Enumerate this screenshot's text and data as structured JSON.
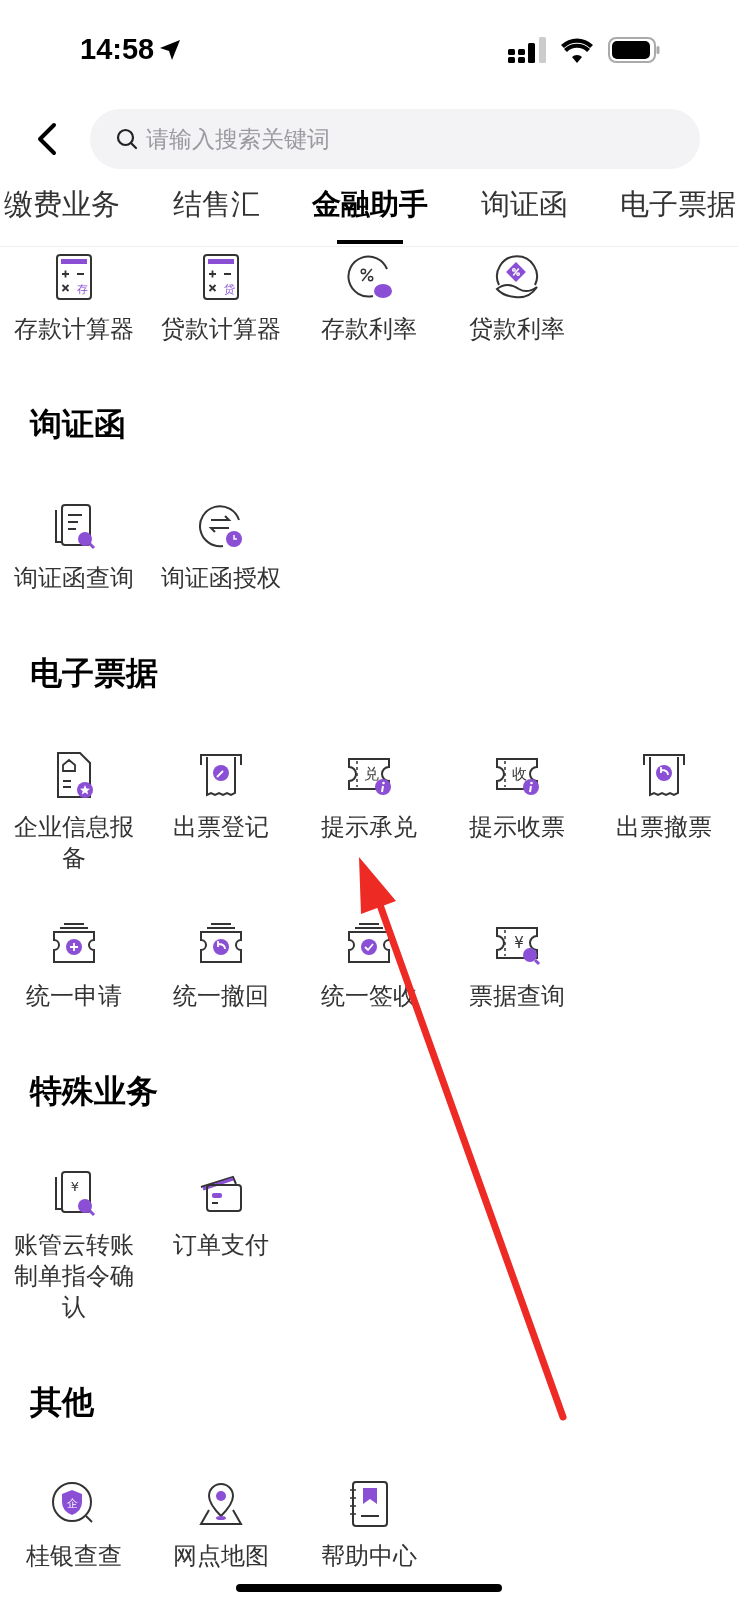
{
  "status_bar": {
    "time": "14:58"
  },
  "search": {
    "placeholder": "请输入搜索关键词"
  },
  "tabs": [
    {
      "label": "缴费业务",
      "selected": false
    },
    {
      "label": "结售汇",
      "selected": false
    },
    {
      "label": "金融助手",
      "selected": true
    },
    {
      "label": "询证函",
      "selected": false
    },
    {
      "label": "电子票据",
      "selected": false
    }
  ],
  "top_items": [
    {
      "label": "存款计算器",
      "kind": "calculator",
      "glyph": "存"
    },
    {
      "label": "贷款计算器",
      "kind": "calculator",
      "glyph": "贷"
    },
    {
      "label": "存款利率",
      "kind": "piggybank"
    },
    {
      "label": "贷款利率",
      "kind": "hand"
    }
  ],
  "sections": [
    {
      "title": "询证函",
      "items": [
        {
          "label": "询证函查询",
          "kind": "docsearch"
        },
        {
          "label": "询证函授权",
          "kind": "exchange"
        }
      ]
    },
    {
      "title": "电子票据",
      "items": [
        {
          "label": "企业信息报备",
          "kind": "docstar"
        },
        {
          "label": "出票登记",
          "kind": "receiptedit"
        },
        {
          "label": "提示承兑",
          "kind": "ticketinfo",
          "glyph": "兑"
        },
        {
          "label": "提示收票",
          "kind": "ticketinfo",
          "glyph": "收"
        },
        {
          "label": "出票撤票",
          "kind": "receiptundo"
        },
        {
          "label": "统一申请",
          "kind": "stackplus"
        },
        {
          "label": "统一撤回",
          "kind": "stackundo"
        },
        {
          "label": "统一签收",
          "kind": "stackcheck"
        },
        {
          "label": "票据查询",
          "kind": "ticketsearch",
          "glyph": "¥"
        }
      ]
    },
    {
      "title": "特殊业务",
      "items": [
        {
          "label": "账管云转账制单指令确认",
          "kind": "docsearch",
          "glyph": "¥"
        },
        {
          "label": "订单支付",
          "kind": "cards"
        }
      ]
    },
    {
      "title": "其他",
      "items": [
        {
          "label": "桂银查查",
          "kind": "shield",
          "glyph": "企"
        },
        {
          "label": "网点地图",
          "kind": "mappin"
        },
        {
          "label": "帮助中心",
          "kind": "book"
        }
      ]
    }
  ]
}
